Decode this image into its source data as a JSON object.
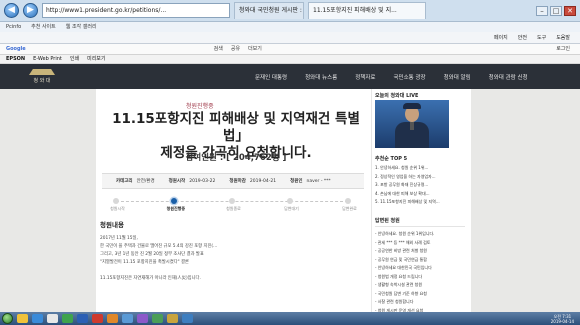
{
  "browser": {
    "address": "http://www1.president.go.kr/petitions/...",
    "tabs": [
      {
        "label": "청와대 국민청원 게시판 : 대..."
      },
      {
        "label": "11.15포항지진 피해배상 및 지..."
      }
    ],
    "favorites": [
      "Pcinfo",
      "추천 사이트",
      "웹 조각 갤러리"
    ],
    "toolbar": [
      "페이지",
      "안전",
      "도구",
      "도움말"
    ],
    "google_label": "Google",
    "google_items": [
      "검색",
      "공유",
      "더보기",
      "로그인"
    ],
    "epson_label": "EPSON",
    "epson_items": [
      "E-Web Print",
      "인쇄",
      "미리보기"
    ]
  },
  "site": {
    "logo_text": "청 와 대",
    "nav": [
      "문재인 대통령",
      "청와대 뉴스룸",
      "정책자료",
      "국민소통 광장",
      "청와대 알림",
      "청와대 관람 신청"
    ]
  },
  "petition": {
    "badge": "청원진행중",
    "title_line1": "11.15포항지진 피해배상 및 지역재건 특별법」",
    "title_line2": "제정을 간곡히 요청합니다.",
    "count_label": "참여인원 : [ 204,762명 ]",
    "meta": [
      {
        "key": "카테고리",
        "value": "안전/환경"
      },
      {
        "key": "청원시작",
        "value": "2019-03-22"
      },
      {
        "key": "청원마감",
        "value": "2019-04-21"
      },
      {
        "key": "청원인",
        "value": "naver - ***"
      }
    ],
    "progress": [
      "청원시작",
      "청원진행중",
      "청원종료",
      "답변대기",
      "답변완료"
    ],
    "progress_current": 1,
    "section_title": "청원내용",
    "body": [
      "2017년 11월 15일,",
      "한 국민이 을 주택과 건물로 떨어진 규모 5.4의 강진 포항 지진(...",
      "그리고, 3년 1년 동안 진 2월 20일 정부 조사단 결과 발표",
      "\"지열발전이 11.15 포항지진을 촉발시켰다\" 결론",
      "",
      "11.15포항지진은 자연재해가 아니라 인재(人災)입니다."
    ]
  },
  "sidebar": {
    "live_title": "오늘의 청와대 LIVE",
    "top5_title": "추천순 TOP 5",
    "top5": [
      "1. 안녕하세요. 청원 순위 1위...",
      "2. 정상적인 영업을 하는 자영업자...",
      "3. 포항 공무원 화재 진상규명...",
      "4. 손님에 대한 피해 보상 확대...",
      "5. 11.15포항지진 피해배상 및 지역..."
    ],
    "hot_title": "답변된 청원",
    "hot": [
      "- 안녕하세요. 청원 순위 1위입니다.",
      "- 관세 *** 등 *** 해외 사례 검토",
      "- 공공연한 비방 관련 처벌 청원",
      "- 공무원 연금 및 국민연금 통합",
      "- 안녕하세요 대한민국 국민입니다",
      "- 청원법 개정 요청 드립니다",
      "- 생활형 숙박시설 관련 청원",
      "- 국민청원 답변 기준 하향 요청",
      "- 사찰 관련 청원합니다",
      "- 청원 게시판 운영 개선 요청"
    ]
  },
  "taskbar": {
    "time": "오전 7:31",
    "date": "2019-04-14",
    "icon_colors": [
      "#f0c23a",
      "#3a8bd9",
      "#e8e8e8",
      "#3fa34d",
      "#2b5fb4",
      "#ce3a2e",
      "#e0882a",
      "#5a9ad6",
      "#8b59c9",
      "#4b9e58",
      "#c9a43d",
      "#3d7ec0"
    ]
  }
}
